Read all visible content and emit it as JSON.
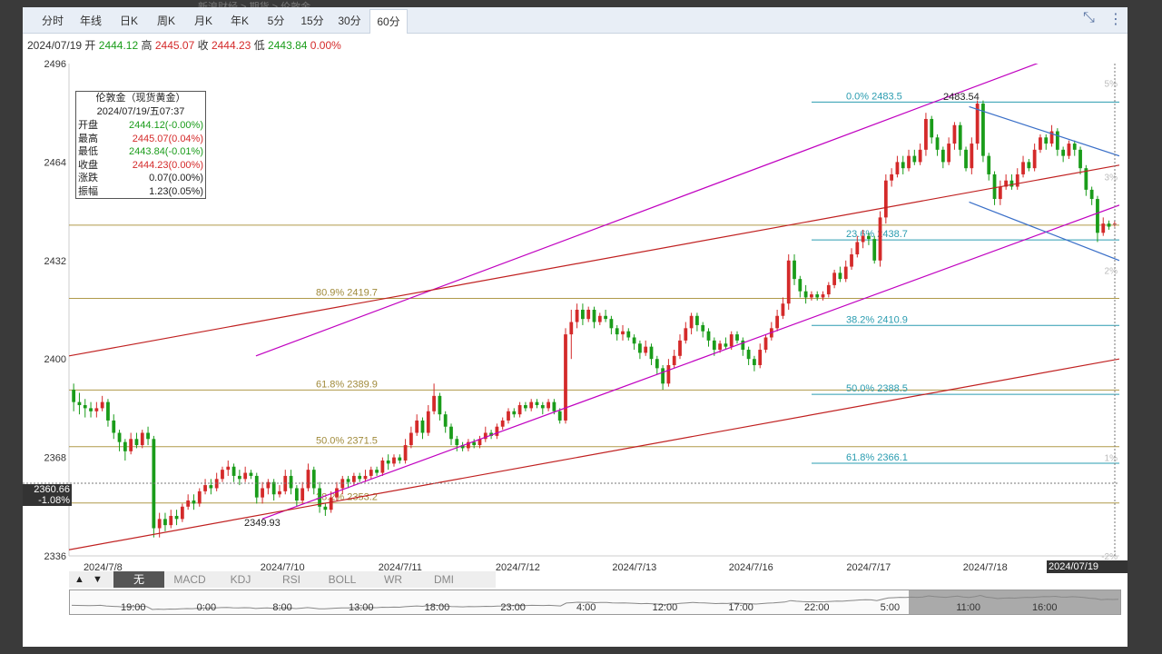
{
  "breadcrumb": "新浪财经 > 期货 > 伦敦金",
  "tabs": [
    "分时",
    "年线",
    "日K",
    "周K",
    "月K",
    "年K",
    "5分",
    "15分",
    "30分",
    "60分"
  ],
  "active_tab_index": 9,
  "icons": {
    "fullscreen": "compress-icon",
    "more": "more-vertical-icon"
  },
  "ohlc": {
    "date": "2024/07/19",
    "open_label": "开",
    "open": "2444.12",
    "high_label": "高",
    "high": "2445.07",
    "close_label": "收",
    "close": "2444.23",
    "low_label": "低",
    "low": "2443.84",
    "change": "0.00%"
  },
  "info_box": {
    "title": "伦敦金（现货黄金）",
    "datetime": "2024/07/19/五07:37",
    "rows": [
      {
        "label": "开盘",
        "value": "2444.12(-0.00%)",
        "color": "#1a9c1a"
      },
      {
        "label": "最高",
        "value": "2445.07(0.04%)",
        "color": "#d42a2a"
      },
      {
        "label": "最低",
        "value": "2443.84(-0.01%)",
        "color": "#1a9c1a"
      },
      {
        "label": "收盘",
        "value": "2444.23(0.00%)",
        "color": "#d42a2a"
      },
      {
        "label": "涨跌",
        "value": "0.07(0.00%)",
        "color": "#222222"
      },
      {
        "label": "振幅",
        "value": "1.23(0.05%)",
        "color": "#222222"
      }
    ]
  },
  "indicators": [
    "无",
    "MACD",
    "KDJ",
    "RSI",
    "BOLL",
    "WR",
    "DMI"
  ],
  "active_indicator_index": 0,
  "arrows": {
    "up": "▲",
    "down": "▼"
  },
  "navigator": {
    "labels": [
      "19:00",
      "0:00",
      "8:00",
      "13:00",
      "18:00",
      "23:00",
      "4:00",
      "12:00",
      "17:00",
      "22:00",
      "5:00",
      "11:00",
      "16:00"
    ]
  },
  "crosshair": {
    "price": "2360.66",
    "pct": "-1.08%",
    "datetime": "2024/07/19 07:37"
  },
  "chart_data": {
    "type": "candlestick",
    "y_ticks": [
      2336,
      2368,
      2400,
      2432,
      2464,
      2496
    ],
    "y_range": [
      2336,
      2496
    ],
    "right_pct_ticks": [
      "5%",
      "3%",
      "2%",
      "1%",
      "-2%"
    ],
    "x_ticks": [
      "2024/7/8",
      "2024/7/10",
      "2024/7/11",
      "2024/7/12",
      "2024/7/13",
      "2024/7/16",
      "2024/7/17",
      "2024/7/18"
    ],
    "annotations": {
      "low_label": "2349.93",
      "high_label": "2483.54"
    },
    "fib_left": [
      {
        "label": "80.9% 2419.7",
        "price": 2419.7
      },
      {
        "label": "61.8% 2389.9",
        "price": 2389.9
      },
      {
        "label": "50.0% 2371.5",
        "price": 2371.5
      },
      {
        "label": "38.2% 2353.2",
        "price": 2353.2
      }
    ],
    "fib_left_extra_level": 2443.5,
    "fib_right": [
      {
        "label": "0.0% 2483.5",
        "price": 2483.5
      },
      {
        "label": "23.6% 2438.7",
        "price": 2438.7
      },
      {
        "label": "38.2% 2410.9",
        "price": 2410.9
      },
      {
        "label": "50.0% 2388.5",
        "price": 2388.5
      },
      {
        "label": "61.8% 2366.1",
        "price": 2366.1
      }
    ],
    "trend_lines": [
      {
        "color": "#c000c0",
        "from": [
          0.178,
          2401
        ],
        "to": [
          0.984,
          2504
        ]
      },
      {
        "color": "#c000c0",
        "from": [
          0.184,
          2348
        ],
        "to": [
          1.0,
          2450
        ]
      },
      {
        "color": "#c02020",
        "from": [
          0.0,
          2401
        ],
        "to": [
          1.0,
          2463
        ]
      },
      {
        "color": "#c02020",
        "from": [
          0.0,
          2338
        ],
        "to": [
          1.0,
          2400
        ]
      },
      {
        "color": "#3a6fc8",
        "from": [
          0.857,
          2482
        ],
        "to": [
          1.0,
          2466
        ]
      },
      {
        "color": "#3a6fc8",
        "from": [
          0.857,
          2451
        ],
        "to": [
          1.0,
          2432
        ]
      }
    ],
    "candles": [
      [
        2390,
        2386,
        2392,
        2383
      ],
      [
        2386,
        2385,
        2389,
        2382
      ],
      [
        2385,
        2384,
        2387,
        2381
      ],
      [
        2384,
        2383,
        2386,
        2381
      ],
      [
        2383,
        2384,
        2386,
        2381
      ],
      [
        2384,
        2386,
        2388,
        2383
      ],
      [
        2386,
        2380,
        2387,
        2378
      ],
      [
        2380,
        2376,
        2382,
        2374
      ],
      [
        2376,
        2373,
        2377,
        2370
      ],
      [
        2373,
        2370,
        2374,
        2367
      ],
      [
        2370,
        2374,
        2376,
        2369
      ],
      [
        2374,
        2372,
        2376,
        2371
      ],
      [
        2372,
        2376,
        2377,
        2371
      ],
      [
        2376,
        2374,
        2378,
        2372
      ],
      [
        2374,
        2345,
        2375,
        2342
      ],
      [
        2345,
        2348,
        2350,
        2342
      ],
      [
        2348,
        2346,
        2350,
        2344
      ],
      [
        2346,
        2349,
        2351,
        2345
      ],
      [
        2349,
        2348,
        2351,
        2346
      ],
      [
        2348,
        2352,
        2353,
        2347
      ],
      [
        2352,
        2354,
        2356,
        2351
      ],
      [
        2354,
        2353,
        2356,
        2351
      ],
      [
        2353,
        2357,
        2358,
        2352
      ],
      [
        2357,
        2359,
        2361,
        2356
      ],
      [
        2359,
        2358,
        2361,
        2356
      ],
      [
        2358,
        2361,
        2363,
        2357
      ],
      [
        2361,
        2364,
        2365,
        2360
      ],
      [
        2364,
        2365,
        2367,
        2362
      ],
      [
        2365,
        2362,
        2366,
        2360
      ],
      [
        2362,
        2361,
        2364,
        2359
      ],
      [
        2361,
        2363,
        2365,
        2360
      ],
      [
        2363,
        2362,
        2364,
        2361
      ],
      [
        2362,
        2355,
        2363,
        2353
      ],
      [
        2355,
        2358,
        2360,
        2353
      ],
      [
        2358,
        2360,
        2361,
        2356
      ],
      [
        2360,
        2356,
        2361,
        2354
      ],
      [
        2356,
        2357,
        2359,
        2355
      ],
      [
        2357,
        2362,
        2364,
        2356
      ],
      [
        2362,
        2358,
        2364,
        2356
      ],
      [
        2358,
        2354,
        2359,
        2352
      ],
      [
        2354,
        2358,
        2360,
        2353
      ],
      [
        2358,
        2364,
        2366,
        2357
      ],
      [
        2364,
        2358,
        2365,
        2356
      ],
      [
        2358,
        2352,
        2360,
        2350
      ],
      [
        2352,
        2351,
        2353,
        2349
      ],
      [
        2351,
        2355,
        2357,
        2350
      ],
      [
        2355,
        2358,
        2360,
        2354
      ],
      [
        2358,
        2361,
        2362,
        2356
      ],
      [
        2361,
        2360,
        2362,
        2358
      ],
      [
        2360,
        2362,
        2363,
        2359
      ],
      [
        2362,
        2361,
        2363,
        2360
      ],
      [
        2361,
        2362,
        2364,
        2360
      ],
      [
        2362,
        2364,
        2365,
        2361
      ],
      [
        2364,
        2363,
        2365,
        2362
      ],
      [
        2363,
        2367,
        2368,
        2362
      ],
      [
        2367,
        2366,
        2369,
        2364
      ],
      [
        2366,
        2368,
        2369,
        2365
      ],
      [
        2368,
        2367,
        2369,
        2366
      ],
      [
        2367,
        2372,
        2374,
        2366
      ],
      [
        2372,
        2376,
        2378,
        2371
      ],
      [
        2376,
        2380,
        2382,
        2375
      ],
      [
        2380,
        2376,
        2381,
        2374
      ],
      [
        2376,
        2383,
        2385,
        2375
      ],
      [
        2383,
        2388,
        2392,
        2382
      ],
      [
        2388,
        2382,
        2389,
        2380
      ],
      [
        2382,
        2378,
        2383,
        2376
      ],
      [
        2378,
        2374,
        2379,
        2372
      ],
      [
        2374,
        2372,
        2375,
        2370
      ],
      [
        2372,
        2371,
        2373,
        2370
      ],
      [
        2371,
        2373,
        2374,
        2370
      ],
      [
        2373,
        2372,
        2374,
        2371
      ],
      [
        2372,
        2374,
        2375,
        2371
      ],
      [
        2374,
        2376,
        2378,
        2373
      ],
      [
        2376,
        2375,
        2377,
        2374
      ],
      [
        2375,
        2378,
        2379,
        2374
      ],
      [
        2378,
        2380,
        2381,
        2377
      ],
      [
        2380,
        2383,
        2384,
        2379
      ],
      [
        2383,
        2382,
        2384,
        2381
      ],
      [
        2382,
        2385,
        2386,
        2381
      ],
      [
        2385,
        2384,
        2386,
        2383
      ],
      [
        2384,
        2386,
        2387,
        2383
      ],
      [
        2386,
        2385,
        2387,
        2384
      ],
      [
        2385,
        2384,
        2386,
        2382
      ],
      [
        2384,
        2386,
        2387,
        2383
      ],
      [
        2386,
        2383,
        2387,
        2382
      ],
      [
        2383,
        2380,
        2384,
        2379
      ],
      [
        2380,
        2408,
        2410,
        2379
      ],
      [
        2408,
        2412,
        2416,
        2400
      ],
      [
        2412,
        2416,
        2418,
        2410
      ],
      [
        2416,
        2413,
        2418,
        2411
      ],
      [
        2413,
        2416,
        2417,
        2412
      ],
      [
        2416,
        2412,
        2417,
        2410
      ],
      [
        2412,
        2414,
        2415,
        2411
      ],
      [
        2414,
        2413,
        2416,
        2412
      ],
      [
        2413,
        2410,
        2414,
        2408
      ],
      [
        2410,
        2408,
        2411,
        2406
      ],
      [
        2408,
        2409,
        2411,
        2406
      ],
      [
        2409,
        2407,
        2410,
        2406
      ],
      [
        2407,
        2405,
        2408,
        2403
      ],
      [
        2405,
        2402,
        2406,
        2400
      ],
      [
        2402,
        2404,
        2406,
        2401
      ],
      [
        2404,
        2400,
        2405,
        2398
      ],
      [
        2400,
        2397,
        2401,
        2395
      ],
      [
        2397,
        2392,
        2398,
        2390
      ],
      [
        2392,
        2398,
        2400,
        2391
      ],
      [
        2398,
        2401,
        2403,
        2397
      ],
      [
        2401,
        2406,
        2408,
        2400
      ],
      [
        2406,
        2410,
        2412,
        2405
      ],
      [
        2410,
        2414,
        2415,
        2408
      ],
      [
        2414,
        2411,
        2415,
        2409
      ],
      [
        2411,
        2409,
        2412,
        2407
      ],
      [
        2409,
        2406,
        2410,
        2404
      ],
      [
        2406,
        2403,
        2407,
        2401
      ],
      [
        2403,
        2405,
        2406,
        2402
      ],
      [
        2405,
        2404,
        2407,
        2403
      ],
      [
        2404,
        2408,
        2409,
        2403
      ],
      [
        2408,
        2406,
        2409,
        2405
      ],
      [
        2406,
        2403,
        2407,
        2401
      ],
      [
        2403,
        2400,
        2404,
        2398
      ],
      [
        2400,
        2398,
        2401,
        2396
      ],
      [
        2398,
        2403,
        2405,
        2397
      ],
      [
        2403,
        2407,
        2408,
        2402
      ],
      [
        2407,
        2410,
        2412,
        2406
      ],
      [
        2410,
        2414,
        2416,
        2409
      ],
      [
        2414,
        2418,
        2420,
        2413
      ],
      [
        2418,
        2432,
        2434,
        2416
      ],
      [
        2432,
        2426,
        2434,
        2424
      ],
      [
        2426,
        2422,
        2427,
        2420
      ],
      [
        2422,
        2420,
        2424,
        2418
      ],
      [
        2420,
        2421,
        2422,
        2419
      ],
      [
        2421,
        2420,
        2422,
        2419
      ],
      [
        2420,
        2421,
        2422,
        2419
      ],
      [
        2421,
        2424,
        2425,
        2420
      ],
      [
        2424,
        2428,
        2429,
        2423
      ],
      [
        2428,
        2426,
        2430,
        2425
      ],
      [
        2426,
        2430,
        2432,
        2425
      ],
      [
        2430,
        2434,
        2436,
        2429
      ],
      [
        2434,
        2438,
        2440,
        2433
      ],
      [
        2438,
        2440,
        2442,
        2436
      ],
      [
        2440,
        2439,
        2441,
        2437
      ],
      [
        2439,
        2432,
        2440,
        2431
      ],
      [
        2432,
        2446,
        2448,
        2430
      ],
      [
        2446,
        2458,
        2460,
        2444
      ],
      [
        2458,
        2460,
        2462,
        2456
      ],
      [
        2460,
        2464,
        2466,
        2459
      ],
      [
        2464,
        2462,
        2466,
        2460
      ],
      [
        2462,
        2466,
        2468,
        2461
      ],
      [
        2466,
        2464,
        2468,
        2463
      ],
      [
        2464,
        2468,
        2470,
        2463
      ],
      [
        2468,
        2478,
        2480,
        2466
      ],
      [
        2478,
        2472,
        2479,
        2470
      ],
      [
        2472,
        2468,
        2473,
        2466
      ],
      [
        2468,
        2464,
        2469,
        2462
      ],
      [
        2464,
        2470,
        2472,
        2463
      ],
      [
        2470,
        2476,
        2477,
        2468
      ],
      [
        2476,
        2468,
        2477,
        2466
      ],
      [
        2468,
        2462,
        2469,
        2461
      ],
      [
        2462,
        2470,
        2472,
        2460
      ],
      [
        2470,
        2483,
        2484,
        2468
      ],
      [
        2483,
        2466,
        2484,
        2464
      ],
      [
        2466,
        2460,
        2467,
        2458
      ],
      [
        2460,
        2452,
        2461,
        2450
      ],
      [
        2452,
        2456,
        2458,
        2450
      ],
      [
        2456,
        2458,
        2460,
        2455
      ],
      [
        2458,
        2456,
        2460,
        2455
      ],
      [
        2456,
        2460,
        2462,
        2455
      ],
      [
        2460,
        2464,
        2466,
        2459
      ],
      [
        2464,
        2462,
        2465,
        2461
      ],
      [
        2462,
        2468,
        2470,
        2461
      ],
      [
        2468,
        2472,
        2473,
        2467
      ],
      [
        2472,
        2470,
        2473,
        2468
      ],
      [
        2470,
        2474,
        2476,
        2469
      ],
      [
        2474,
        2468,
        2475,
        2466
      ],
      [
        2468,
        2466,
        2469,
        2464
      ],
      [
        2466,
        2470,
        2471,
        2465
      ],
      [
        2470,
        2468,
        2471,
        2466
      ],
      [
        2468,
        2462,
        2469,
        2460
      ],
      [
        2462,
        2455,
        2463,
        2453
      ],
      [
        2455,
        2452,
        2456,
        2450
      ],
      [
        2452,
        2441,
        2453,
        2438
      ],
      [
        2441,
        2444,
        2446,
        2440
      ],
      [
        2444,
        2443,
        2445,
        2442
      ],
      [
        2444,
        2444,
        2445,
        2443
      ]
    ]
  }
}
